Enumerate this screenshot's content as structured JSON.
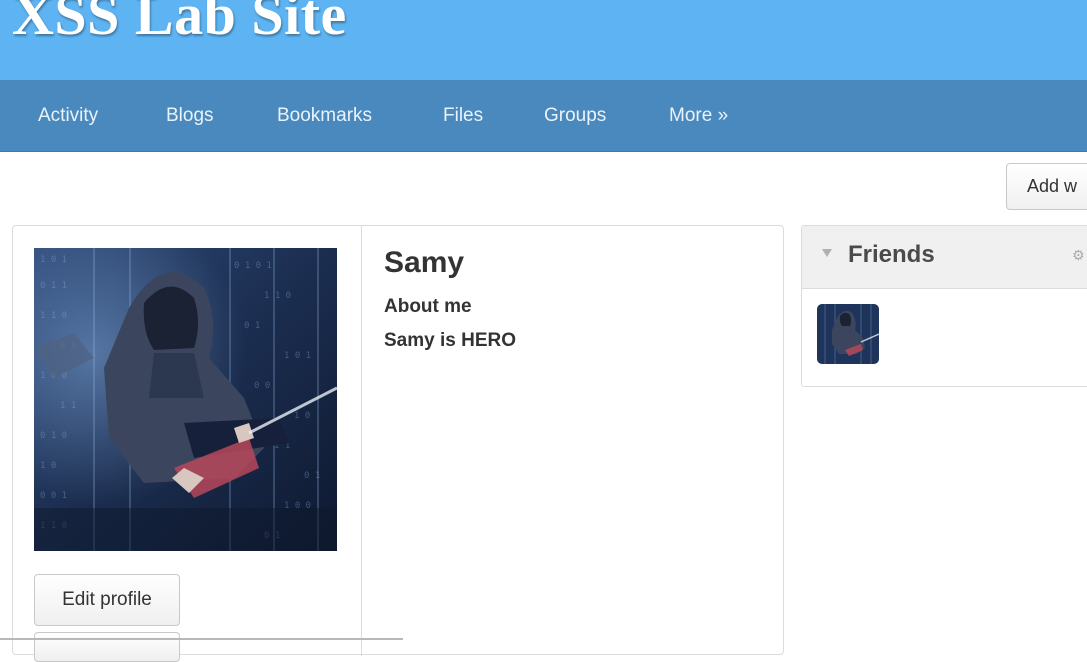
{
  "site": {
    "title": "XSS Lab Site"
  },
  "nav": {
    "items": [
      {
        "label": "Activity"
      },
      {
        "label": "Blogs"
      },
      {
        "label": "Bookmarks"
      },
      {
        "label": "Files"
      },
      {
        "label": "Groups"
      },
      {
        "label": "More »"
      }
    ]
  },
  "toolbar": {
    "add_widgets_label": "Add w"
  },
  "profile": {
    "name": "Samy",
    "about_label": "About me",
    "about_text": "Samy is HERO",
    "edit_label": "Edit profile",
    "avatar_icon": "hacker-photo"
  },
  "friends": {
    "title": "Friends",
    "toggle_icon": "triangle-down-icon",
    "settings_icon": "gear-icon",
    "items": [
      {
        "avatar_icon": "hacker-photo"
      }
    ]
  },
  "colors": {
    "banner": "#5eb4f2",
    "navbar": "#4a89bd",
    "panel_header": "#f0f0f0"
  }
}
